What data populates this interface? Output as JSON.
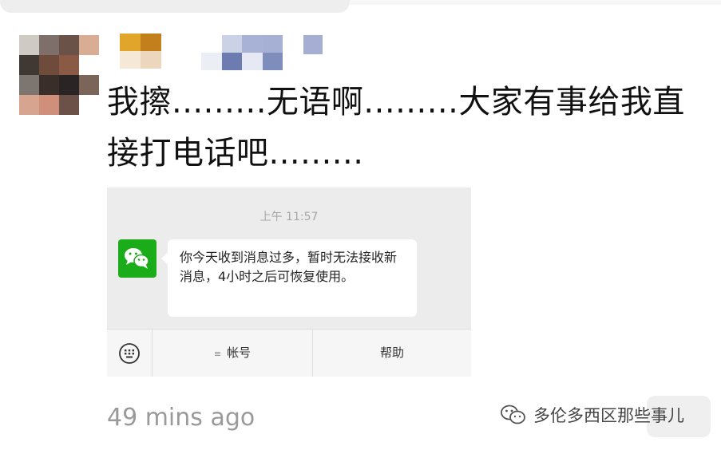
{
  "post": {
    "text": "我擦.........无语啊.........大家有事给我直接打电话吧.........",
    "time_ago": "49 mins ago"
  },
  "screenshot": {
    "time": "上午 11:57",
    "message": "你今天收到消息过多，暂时无法接收新消息，4小时之后可恢复使用。",
    "menu": {
      "account_label": "帐号",
      "account_icon": "≡",
      "help_label": "帮助"
    },
    "icons": {
      "sender": "wechat-logo-icon",
      "keyboard": "keyboard-icon"
    }
  },
  "watermark": {
    "text": "多伦多西区那些事儿",
    "icon": "wechat-logo-icon"
  },
  "colors": {
    "wechat_green": "#1aad19",
    "panel_gray": "#ececec",
    "secondary_text": "#9a9a9a"
  }
}
